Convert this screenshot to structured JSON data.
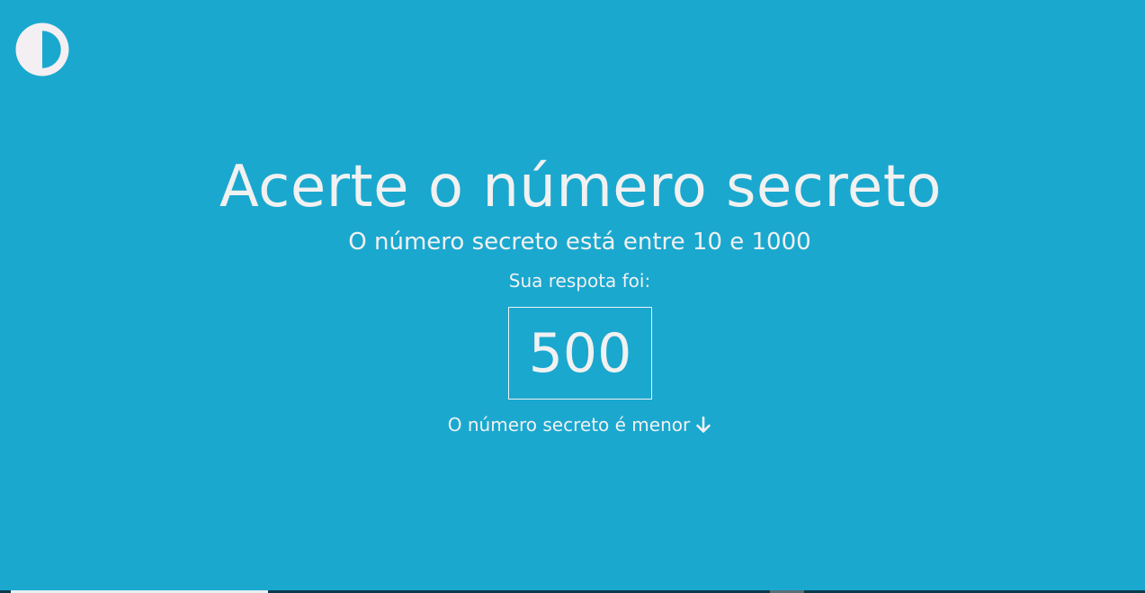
{
  "theme_toggle": {
    "icon": "half-circle-contrast-icon"
  },
  "title": "Acerte o número secreto",
  "subtitle": "O número secreto está entre 10 e 1000",
  "answer": {
    "label": "Sua respota foi:",
    "value": "500"
  },
  "hint": {
    "text": "O número secreto é menor",
    "icon": "arrow-down-icon"
  },
  "colors": {
    "background": "#1aa8cf",
    "text": "#f1f1f1"
  }
}
